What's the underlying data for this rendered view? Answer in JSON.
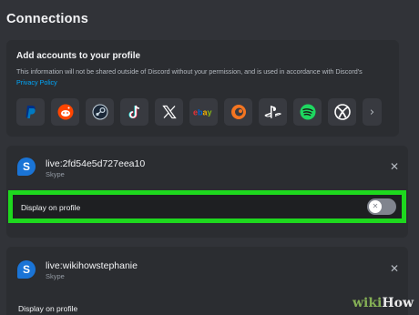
{
  "header": {
    "title": "Connections"
  },
  "add_accounts": {
    "title": "Add accounts to your profile",
    "description": "This information will not be shared outside of Discord without your permission, and is used in accordance with Discord's",
    "privacy_link": "Privacy Policy",
    "services": [
      "paypal-icon",
      "reddit-icon",
      "steam-icon",
      "tiktok-icon",
      "x-icon",
      "ebay-icon",
      "crunchyroll-icon",
      "playstation-icon",
      "spotify-icon",
      "xbox-icon"
    ],
    "more_glyph": "›"
  },
  "accounts": [
    {
      "name": "live:2fd54e5d727eea10",
      "service": "Skype",
      "display_on_profile_label": "Display on profile",
      "display_on_profile": false
    },
    {
      "name": "live:wikihowstephanie",
      "service": "Skype",
      "display_on_profile_label": "Display on profile"
    }
  ],
  "watermark": {
    "left": "wiki",
    "right": "How"
  },
  "colors": {
    "background": "#313338",
    "card": "#2b2d31",
    "highlight": "#1ed81e",
    "link": "#00a8fc",
    "skype": "#1a74d6"
  }
}
